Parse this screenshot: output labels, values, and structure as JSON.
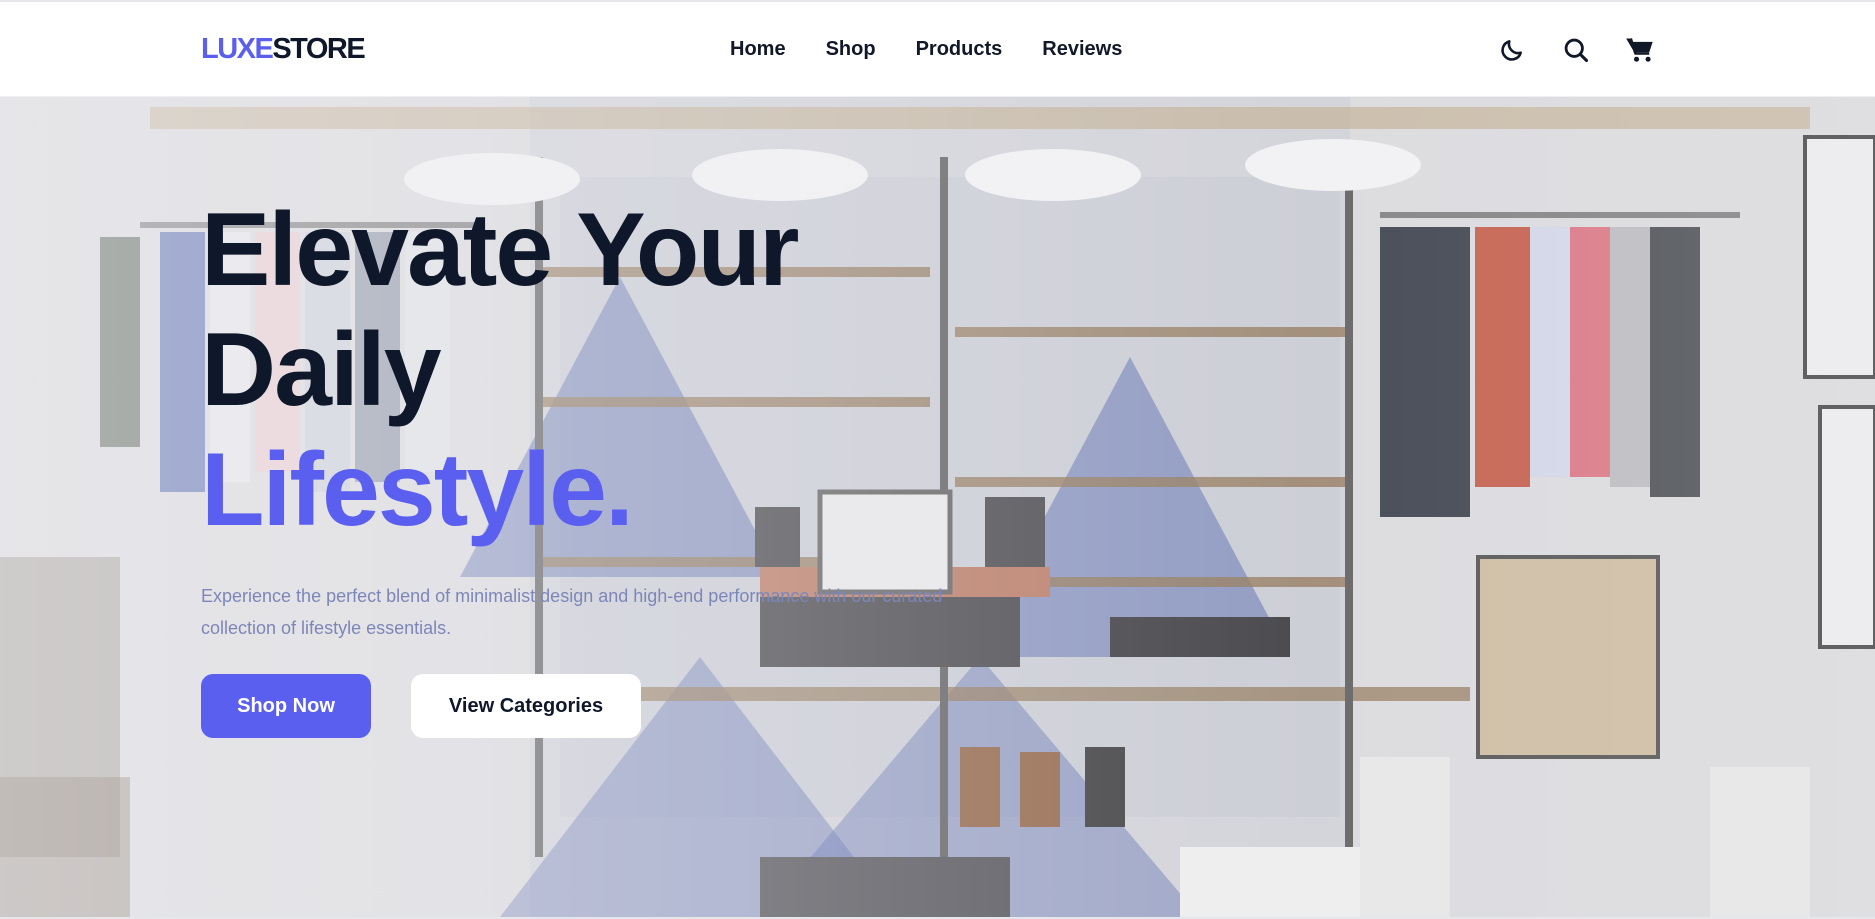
{
  "brand": {
    "logo_accent": "LUXE",
    "logo_rest": "STORE",
    "accent_color": "#5b5ff0"
  },
  "nav": {
    "links": [
      {
        "label": "Home"
      },
      {
        "label": "Shop"
      },
      {
        "label": "Products"
      },
      {
        "label": "Reviews"
      }
    ],
    "icons": [
      "moon-icon",
      "search-icon",
      "cart-icon"
    ]
  },
  "hero": {
    "headline_line1": "Elevate Your",
    "headline_line2": "Daily",
    "headline_accent": "Lifestyle.",
    "subtext": "Experience the perfect blend of minimalist design and high-end performance with our curated collection of lifestyle essentials.",
    "primary_cta": "Shop Now",
    "secondary_cta": "View Categories",
    "background": "store-interior-photo"
  }
}
